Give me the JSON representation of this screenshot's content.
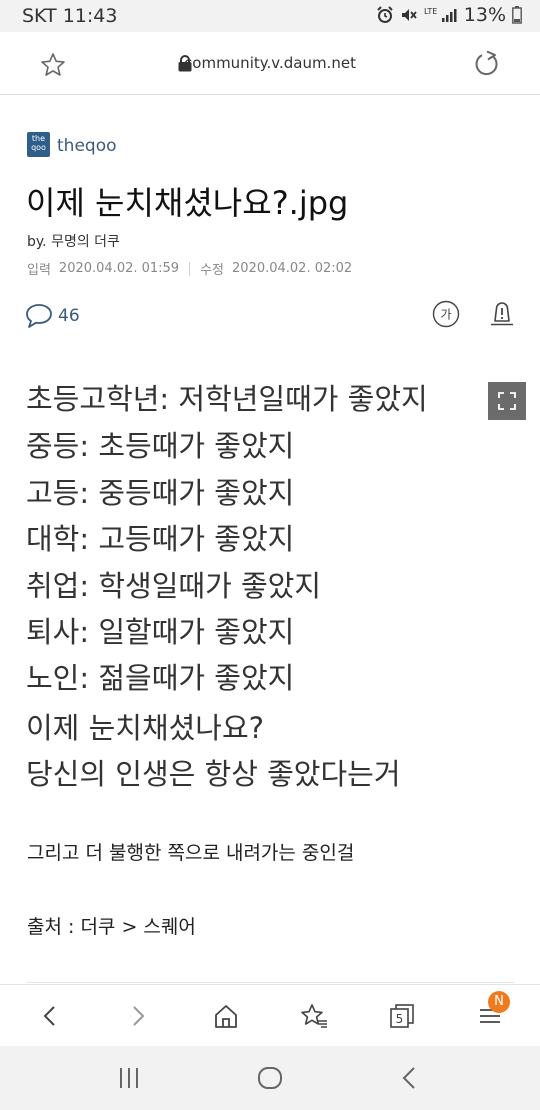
{
  "status_bar": {
    "carrier": "SKT",
    "time": "11:43",
    "battery": "13%"
  },
  "browser": {
    "url": "community.v.daum.net"
  },
  "article": {
    "site_name": "theqoo",
    "logo_text": "the qoo",
    "title": "이제 눈치채셨나요?.jpg",
    "author": "by. 무명의 더쿠",
    "posted_label": "입력",
    "posted_date": "2020.04.02. 01:59",
    "edited_label": "수정",
    "edited_date": "2020.04.02. 02:02",
    "comment_count": "46",
    "font_size_label": "가"
  },
  "image_lines": [
    "초등고학년: 저학년일때가 좋았지",
    "중등: 초등때가 좋았지",
    "고등: 중등때가 좋았지",
    "대학: 고등때가 좋았지",
    "취업: 학생일때가 좋았지",
    "퇴사: 일할때가 좋았지",
    "노인: 젊을때가 좋았지",
    "이제 눈치채셨나요?",
    "당신의 인생은 항상 좋았다는거"
  ],
  "body": {
    "paragraph": "그리고 더 불행한 쪽으로 내려가는 중인걸",
    "source": "출처 : 더쿠 > 스퀘어"
  },
  "toolbar": {
    "tabs_count": "5",
    "notification_badge": "N"
  },
  "colors": {
    "accent_blue": "#3a5a7c",
    "badge_orange": "#f07b1e",
    "logo_blue": "#2f5e8a"
  }
}
